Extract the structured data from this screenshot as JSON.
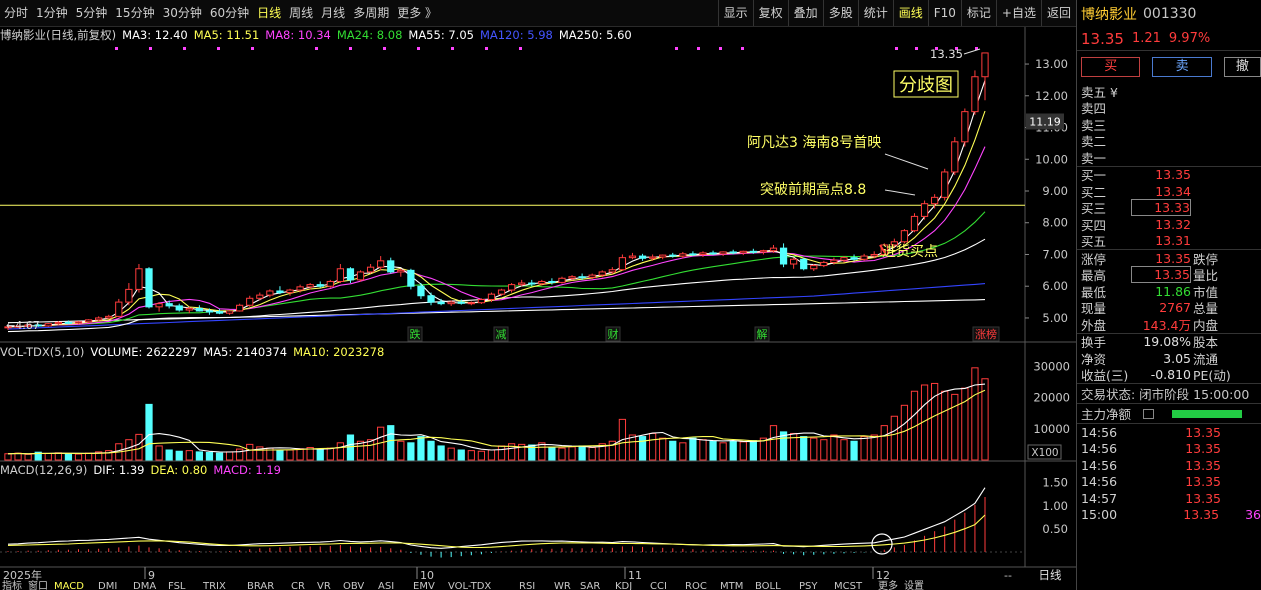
{
  "toolbar": {
    "periods": [
      "分时",
      "1分钟",
      "5分钟",
      "15分钟",
      "30分钟",
      "60分钟",
      "日线",
      "周线",
      "月线",
      "多周期",
      "更多 》"
    ],
    "active_period": 6,
    "tools": [
      "显示",
      "复权",
      "叠加",
      "多股",
      "统计",
      "画线",
      "F10",
      "标记",
      "+自选",
      "返回"
    ],
    "active_tool": 5
  },
  "main_header": {
    "title": "博纳影业(日线,前复权)",
    "ma3": "MA3: 12.40",
    "ma5": "MA5: 11.51",
    "ma8": "MA8: 10.34",
    "ma24": "MA24: 8.08",
    "ma55": "MA55: 7.05",
    "ma120": "MA120: 5.98",
    "ma250": "MA250: 5.60"
  },
  "vol_header": {
    "title": "VOL-TDX(5,10)",
    "volume": "VOLUME: 2622297",
    "ma5": "MA5: 2140374",
    "ma10": "MA10: 2023278"
  },
  "macd_header": {
    "title": "MACD(12,26,9)",
    "dif": "DIF: 1.39",
    "dea": "DEA: 0.80",
    "macd": "MACD: 1.19"
  },
  "annotations": {
    "fenqi": "分歧图",
    "avatar": "阿凡达3 海南8号首映",
    "breakout": "突破前期高点8.8",
    "buy_point": "进货买点",
    "high_label": "13.35",
    "low_label": "←4.67"
  },
  "event_markers": [
    "跌",
    "减",
    "财",
    "解",
    "涨榜"
  ],
  "date_axis": {
    "labels": [
      "2025年",
      "9",
      "10",
      "11",
      "12"
    ],
    "bottom_right": "日线",
    "zoom": "--"
  },
  "indicator_tabs": [
    "指标",
    "窗口",
    "MACD",
    "DMI",
    "DMA",
    "FSL",
    "TRIX",
    "BRAR",
    "CR",
    "VR",
    "OBV",
    "ASI",
    "EMV",
    "VOL-TDX",
    "RSI",
    "WR",
    "SAR",
    "KDJ",
    "CCI",
    "ROC",
    "MTM",
    "BOLL",
    "PSY",
    "MCST",
    "更多",
    "设置"
  ],
  "price_axis": [
    "13.00",
    "12.00",
    "11.00",
    "10.00",
    "9.00",
    "8.00",
    "7.00",
    "6.00",
    "5.00"
  ],
  "price_axis_tag": "11.19",
  "vol_axis": [
    "30000",
    "20000",
    "10000",
    "X100"
  ],
  "macd_axis": [
    "1.50",
    "1.00",
    "0.50"
  ],
  "chart_data": {
    "type": "candlestick",
    "ylim": [
      4.4,
      13.6
    ],
    "ohlc": [
      [
        4.7,
        4.75,
        4.62,
        4.72
      ],
      [
        4.72,
        4.78,
        4.68,
        4.74
      ],
      [
        4.74,
        4.8,
        4.7,
        4.78
      ],
      [
        4.78,
        4.82,
        4.72,
        4.75
      ],
      [
        4.75,
        4.84,
        4.72,
        4.82
      ],
      [
        4.82,
        4.9,
        4.78,
        4.86
      ],
      [
        4.86,
        4.92,
        4.8,
        4.84
      ],
      [
        4.84,
        4.9,
        4.8,
        4.88
      ],
      [
        4.88,
        4.96,
        4.84,
        4.94
      ],
      [
        4.94,
        5.05,
        4.9,
        5.0
      ],
      [
        5.0,
        5.1,
        4.96,
        5.05
      ],
      [
        5.05,
        5.6,
        5.02,
        5.5
      ],
      [
        5.5,
        6.1,
        5.4,
        5.9
      ],
      [
        5.9,
        6.7,
        5.8,
        6.55
      ],
      [
        6.55,
        6.6,
        5.3,
        5.35
      ],
      [
        5.35,
        5.5,
        5.2,
        5.45
      ],
      [
        5.45,
        5.55,
        5.3,
        5.38
      ],
      [
        5.38,
        5.45,
        5.2,
        5.25
      ],
      [
        5.25,
        5.35,
        5.15,
        5.3
      ],
      [
        5.3,
        5.4,
        5.2,
        5.22
      ],
      [
        5.22,
        5.3,
        5.1,
        5.2
      ],
      [
        5.2,
        5.28,
        5.12,
        5.15
      ],
      [
        5.15,
        5.25,
        5.1,
        5.22
      ],
      [
        5.22,
        5.45,
        5.2,
        5.4
      ],
      [
        5.4,
        5.7,
        5.35,
        5.62
      ],
      [
        5.62,
        5.8,
        5.55,
        5.72
      ],
      [
        5.72,
        5.9,
        5.65,
        5.85
      ],
      [
        5.85,
        6.0,
        5.75,
        5.8
      ],
      [
        5.8,
        5.92,
        5.7,
        5.88
      ],
      [
        5.88,
        6.05,
        5.8,
        5.98
      ],
      [
        5.98,
        6.1,
        5.9,
        6.05
      ],
      [
        6.05,
        6.15,
        5.95,
        6.0
      ],
      [
        6.0,
        6.2,
        5.95,
        6.15
      ],
      [
        6.15,
        6.7,
        6.1,
        6.55
      ],
      [
        6.55,
        6.6,
        6.1,
        6.2
      ],
      [
        6.2,
        6.5,
        6.15,
        6.45
      ],
      [
        6.45,
        6.7,
        6.4,
        6.6
      ],
      [
        6.6,
        6.95,
        6.5,
        6.8
      ],
      [
        6.8,
        6.9,
        6.4,
        6.45
      ],
      [
        6.45,
        6.55,
        6.3,
        6.5
      ],
      [
        6.5,
        6.55,
        5.9,
        6.0
      ],
      [
        6.0,
        6.1,
        5.6,
        5.7
      ],
      [
        5.7,
        5.8,
        5.4,
        5.5
      ],
      [
        5.5,
        5.6,
        5.4,
        5.45
      ],
      [
        5.45,
        5.55,
        5.38,
        5.5
      ],
      [
        5.5,
        5.58,
        5.42,
        5.46
      ],
      [
        5.46,
        5.52,
        5.4,
        5.48
      ],
      [
        5.48,
        5.62,
        5.44,
        5.58
      ],
      [
        5.58,
        5.8,
        5.5,
        5.75
      ],
      [
        5.75,
        5.92,
        5.7,
        5.88
      ],
      [
        5.88,
        6.1,
        5.8,
        6.05
      ],
      [
        6.05,
        6.2,
        6.0,
        6.1
      ],
      [
        6.1,
        6.2,
        6.0,
        6.08
      ],
      [
        6.08,
        6.2,
        6.02,
        6.15
      ],
      [
        6.15,
        6.25,
        6.05,
        6.12
      ],
      [
        6.12,
        6.3,
        6.08,
        6.25
      ],
      [
        6.25,
        6.35,
        6.18,
        6.3
      ],
      [
        6.3,
        6.4,
        6.2,
        6.28
      ],
      [
        6.28,
        6.4,
        6.22,
        6.35
      ],
      [
        6.35,
        6.5,
        6.28,
        6.45
      ],
      [
        6.45,
        6.6,
        6.38,
        6.52
      ],
      [
        6.52,
        7.0,
        6.48,
        6.9
      ],
      [
        6.9,
        7.05,
        6.85,
        6.95
      ],
      [
        6.95,
        7.02,
        6.8,
        6.88
      ],
      [
        6.88,
        7.0,
        6.8,
        6.92
      ],
      [
        6.92,
        7.0,
        6.85,
        6.98
      ],
      [
        6.98,
        7.05,
        6.9,
        6.95
      ],
      [
        6.95,
        7.08,
        6.88,
        7.02
      ],
      [
        7.02,
        7.1,
        6.95,
        7.0
      ],
      [
        7.0,
        7.1,
        6.92,
        7.05
      ],
      [
        7.05,
        7.12,
        6.98,
        7.02
      ],
      [
        7.02,
        7.1,
        6.95,
        7.08
      ],
      [
        7.08,
        7.15,
        7.0,
        7.05
      ],
      [
        7.05,
        7.12,
        6.98,
        7.1
      ],
      [
        7.1,
        7.18,
        7.02,
        7.08
      ],
      [
        7.08,
        7.15,
        7.0,
        7.12
      ],
      [
        7.12,
        7.3,
        7.05,
        7.2
      ],
      [
        7.2,
        7.35,
        6.6,
        6.7
      ],
      [
        6.7,
        6.9,
        6.55,
        6.85
      ],
      [
        6.85,
        6.9,
        6.5,
        6.55
      ],
      [
        6.55,
        6.7,
        6.48,
        6.65
      ],
      [
        6.65,
        6.8,
        6.6,
        6.75
      ],
      [
        6.75,
        6.9,
        6.68,
        6.82
      ],
      [
        6.82,
        6.95,
        6.75,
        6.9
      ],
      [
        6.9,
        7.0,
        6.8,
        6.85
      ],
      [
        6.85,
        7.02,
        6.8,
        6.95
      ],
      [
        6.95,
        7.1,
        6.88,
        7.0
      ],
      [
        7.0,
        7.35,
        6.95,
        7.3
      ],
      [
        7.3,
        7.5,
        7.2,
        7.4
      ],
      [
        7.4,
        7.8,
        7.35,
        7.75
      ],
      [
        7.75,
        8.3,
        7.7,
        8.2
      ],
      [
        8.2,
        8.7,
        8.1,
        8.6
      ],
      [
        8.6,
        8.9,
        8.45,
        8.8
      ],
      [
        8.8,
        9.7,
        8.7,
        9.6
      ],
      [
        9.6,
        10.7,
        9.5,
        10.55
      ],
      [
        10.55,
        11.6,
        10.4,
        11.5
      ],
      [
        11.5,
        12.8,
        11.4,
        12.6
      ],
      [
        12.6,
        13.35,
        11.86,
        13.35
      ]
    ],
    "ma_colors": {
      "ma3": "#ffffff",
      "ma5": "#ffff55",
      "ma8": "#ff44ff",
      "ma24": "#33dd33",
      "ma55": "#ffffff",
      "ma120": "#3344ff",
      "ma250": "#ffffff"
    },
    "volume": [
      2000,
      2200,
      1800,
      2500,
      2100,
      2300,
      2000,
      1900,
      2200,
      2600,
      3000,
      5200,
      6500,
      8200,
      17800,
      4500,
      3200,
      2800,
      3000,
      2600,
      2400,
      2200,
      2600,
      3500,
      5000,
      4200,
      3800,
      3000,
      3200,
      3600,
      4000,
      3500,
      3800,
      5500,
      8000,
      6000,
      6500,
      10500,
      11000,
      6000,
      5500,
      7500,
      6000,
      4500,
      3800,
      3200,
      3000,
      2800,
      3200,
      4500,
      5200,
      5000,
      4800,
      5500,
      4000,
      3800,
      4200,
      4500,
      4000,
      5200,
      6000,
      13000,
      8000,
      7500,
      8500,
      7000,
      6000,
      5500,
      7000,
      6500,
      6000,
      5500,
      6000,
      5800,
      6200,
      7000,
      11000,
      9000,
      8500,
      7500,
      7000,
      6500,
      8000,
      6500,
      6000,
      7500,
      8000,
      11000,
      14000,
      17500,
      22000,
      24000,
      24500,
      22000,
      21000,
      23000,
      29500,
      26000
    ],
    "macd_hist": [
      0.02,
      0.02,
      0.03,
      0.03,
      0.04,
      0.05,
      0.05,
      0.06,
      0.06,
      0.07,
      0.08,
      0.1,
      0.12,
      0.14,
      0.1,
      0.08,
      0.06,
      0.04,
      0.03,
      0.02,
      0.01,
      0.01,
      0.02,
      0.04,
      0.06,
      0.08,
      0.09,
      0.1,
      0.11,
      0.12,
      0.12,
      0.12,
      0.13,
      0.15,
      0.12,
      0.1,
      0.1,
      0.11,
      0.08,
      0.05,
      -0.02,
      -0.06,
      -0.1,
      -0.12,
      -0.11,
      -0.09,
      -0.07,
      -0.05,
      -0.02,
      0.01,
      0.03,
      0.05,
      0.06,
      0.07,
      0.07,
      0.08,
      0.08,
      0.08,
      0.08,
      0.09,
      0.09,
      0.12,
      0.12,
      0.11,
      0.1,
      0.09,
      0.08,
      0.07,
      0.06,
      0.05,
      0.05,
      0.04,
      0.04,
      0.03,
      0.03,
      0.03,
      0.03,
      -0.04,
      -0.05,
      -0.07,
      -0.06,
      -0.05,
      -0.04,
      -0.03,
      -0.02,
      -0.01,
      0.0,
      0.05,
      0.1,
      0.15,
      0.25,
      0.35,
      0.45,
      0.55,
      0.7,
      0.85,
      1.02,
      1.19
    ],
    "dif_end": 1.39,
    "dea_end": 0.8
  },
  "quote": {
    "name": "博纳影业",
    "code": "001330",
    "price": "13.35",
    "change": "1.21",
    "pct": "9.97%",
    "buy_label": "买",
    "sell_label": "卖",
    "cancel_label": "撤",
    "sell_book": [
      {
        "label": "卖五 ¥",
        "value": ""
      },
      {
        "label": "卖四",
        "value": ""
      },
      {
        "label": "卖三",
        "value": ""
      },
      {
        "label": "卖二",
        "value": ""
      },
      {
        "label": "卖一",
        "value": ""
      }
    ],
    "buy_book": [
      {
        "label": "买一",
        "value": "13.35"
      },
      {
        "label": "买二",
        "value": "13.34"
      },
      {
        "label": "买三",
        "value": "13.33"
      },
      {
        "label": "买四",
        "value": "13.32"
      },
      {
        "label": "买五",
        "value": "13.31"
      }
    ],
    "stats": [
      {
        "label": "涨停",
        "value": "13.35",
        "label2": "跌停"
      },
      {
        "label": "最高",
        "value": "13.35",
        "label2": "量比"
      },
      {
        "label": "最低",
        "value": "11.86",
        "label2": "市值"
      },
      {
        "label": "现量",
        "value": "2767",
        "label2": "总量"
      },
      {
        "label": "外盘",
        "value": "143.4万",
        "label2": "内盘"
      }
    ],
    "stats2": [
      {
        "label": "换手",
        "value": "19.08%",
        "label2": "股本"
      },
      {
        "label": "净资",
        "value": "3.05",
        "label2": "流通"
      },
      {
        "label": "收益(三)",
        "value": "-0.810",
        "label2": "PE(动)"
      }
    ],
    "trade_status": "交易状态: 闭市阶段 15:00:00",
    "main_flow_label": "主力净额",
    "ticks": [
      {
        "time": "14:56",
        "price": "13.35"
      },
      {
        "time": "14:56",
        "price": "13.35"
      },
      {
        "time": "14:56",
        "price": "13.35"
      },
      {
        "time": "14:56",
        "price": "13.35"
      },
      {
        "time": "14:57",
        "price": "13.35"
      },
      {
        "time": "15:00",
        "price": "13.35"
      }
    ],
    "last_tick_extra": "36"
  }
}
